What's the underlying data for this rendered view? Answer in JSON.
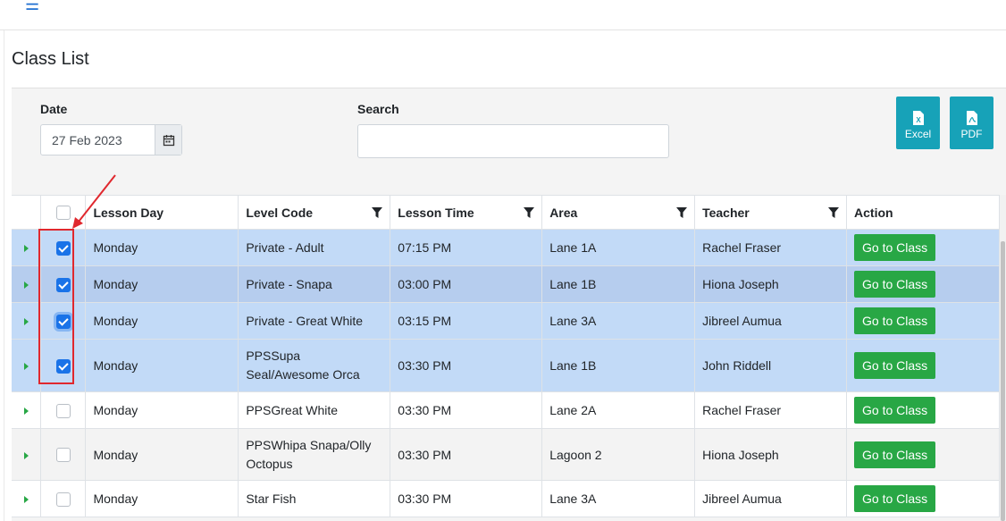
{
  "header": {
    "menu_icon": "hamburger-icon"
  },
  "page": {
    "title": "Class List"
  },
  "filters": {
    "date_label": "Date",
    "date_value": "27 Feb 2023",
    "search_label": "Search",
    "search_value": ""
  },
  "exports": {
    "excel_label": "Excel",
    "pdf_label": "PDF"
  },
  "table": {
    "headers": {
      "lesson_day": "Lesson Day",
      "level_code": "Level Code",
      "lesson_time": "Lesson Time",
      "area": "Area",
      "teacher": "Teacher",
      "action": "Action"
    },
    "rows": [
      {
        "day": "Monday",
        "level": "Private - Adult",
        "time": "07:15 PM",
        "area": "Lane 1A",
        "teacher": "Rachel Fraser",
        "action": "Go to Class",
        "checked": true
      },
      {
        "day": "Monday",
        "level": "Private - Snapa",
        "time": "03:00 PM",
        "area": "Lane 1B",
        "teacher": "Hiona Joseph",
        "action": "Go to Class",
        "checked": true
      },
      {
        "day": "Monday",
        "level": "Private - Great White",
        "time": "03:15 PM",
        "area": "Lane 3A",
        "teacher": "Jibreel Aumua",
        "action": "Go to Class",
        "checked": true
      },
      {
        "day": "Monday",
        "level": "PPSSupa Seal/Awesome Orca",
        "time": "03:30 PM",
        "area": "Lane 1B",
        "teacher": "John Riddell",
        "action": "Go to Class",
        "checked": true
      },
      {
        "day": "Monday",
        "level": "PPSGreat White",
        "time": "03:30 PM",
        "area": "Lane 2A",
        "teacher": "Rachel Fraser",
        "action": "Go to Class",
        "checked": false
      },
      {
        "day": "Monday",
        "level": "PPSWhipa Snapa/Olly Octopus",
        "time": "03:30 PM",
        "area": "Lagoon 2",
        "teacher": "Hiona Joseph",
        "action": "Go to Class",
        "checked": false
      },
      {
        "day": "Monday",
        "level": "Star Fish",
        "time": "03:30 PM",
        "area": "Lane 3A",
        "teacher": "Jibreel Aumua",
        "action": "Go to Class",
        "checked": false
      }
    ]
  },
  "colors": {
    "accent": "#17a2b8",
    "success": "#28a745",
    "selected_row": "#c2daf7",
    "annotation": "#e0282e"
  }
}
